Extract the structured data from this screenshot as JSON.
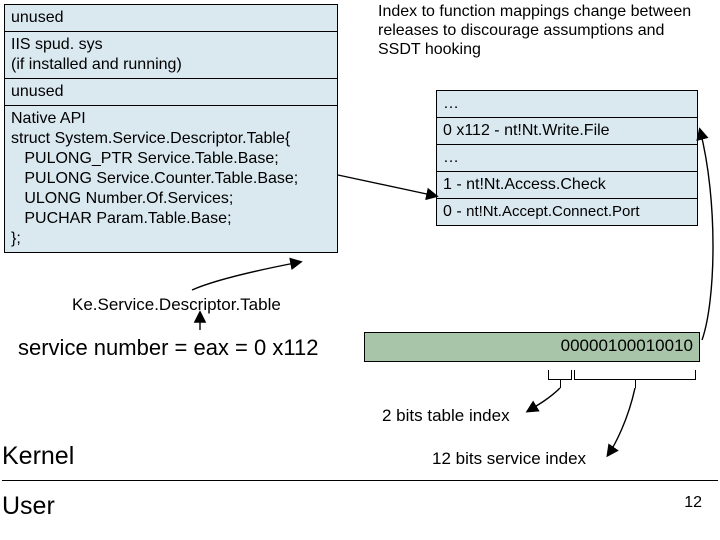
{
  "left_table": {
    "r0": "unused",
    "r1": "IIS spud. sys\n(if installed and running)",
    "r2": "unused",
    "r3": "Native API\nstruct System.Service.Descriptor.Table{\n   PULONG_PTR Service.Table.Base;\n   PULONG Service.Counter.Table.Base;\n   ULONG Number.Of.Services;\n   PUCHAR Param.Table.Base;\n};"
  },
  "top_text": "Index to function mappings change between releases to discourage assumptions and SSDT hooking",
  "right_table": {
    "r0": "…",
    "r1": "0 x112 - nt!Nt.Write.File",
    "r2": "…",
    "r3": "1 - nt!Nt.Access.Check",
    "r4_a": "0 - ",
    "r4_b": "nt!Nt.Accept.Connect.Port"
  },
  "ke_label": "Ke.Service.Descriptor.Table",
  "equation": "service number = eax = 0 x112",
  "binary": "00000100010010",
  "bits2_label": "2 bits table index",
  "bits12_label": "12 bits service index",
  "kernel_label": "Kernel",
  "user_label": "User",
  "slide_number": "12"
}
